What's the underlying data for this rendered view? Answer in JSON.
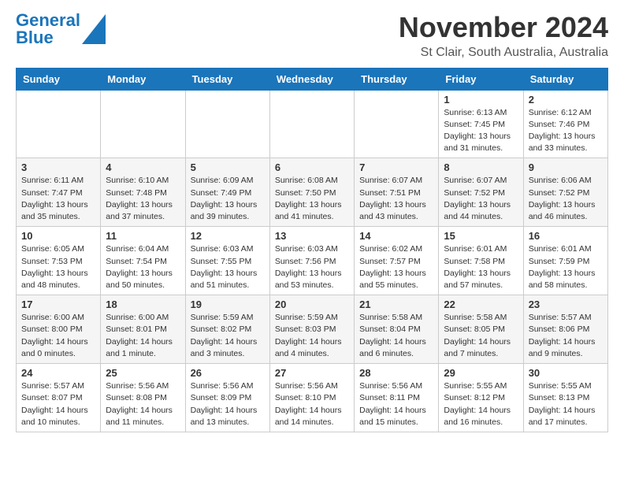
{
  "header": {
    "logo_line1": "General",
    "logo_line2": "Blue",
    "month": "November 2024",
    "location": "St Clair, South Australia, Australia"
  },
  "weekdays": [
    "Sunday",
    "Monday",
    "Tuesday",
    "Wednesday",
    "Thursday",
    "Friday",
    "Saturday"
  ],
  "weeks": [
    [
      {
        "day": "",
        "info": ""
      },
      {
        "day": "",
        "info": ""
      },
      {
        "day": "",
        "info": ""
      },
      {
        "day": "",
        "info": ""
      },
      {
        "day": "",
        "info": ""
      },
      {
        "day": "1",
        "info": "Sunrise: 6:13 AM\nSunset: 7:45 PM\nDaylight: 13 hours and 31 minutes."
      },
      {
        "day": "2",
        "info": "Sunrise: 6:12 AM\nSunset: 7:46 PM\nDaylight: 13 hours and 33 minutes."
      }
    ],
    [
      {
        "day": "3",
        "info": "Sunrise: 6:11 AM\nSunset: 7:47 PM\nDaylight: 13 hours and 35 minutes."
      },
      {
        "day": "4",
        "info": "Sunrise: 6:10 AM\nSunset: 7:48 PM\nDaylight: 13 hours and 37 minutes."
      },
      {
        "day": "5",
        "info": "Sunrise: 6:09 AM\nSunset: 7:49 PM\nDaylight: 13 hours and 39 minutes."
      },
      {
        "day": "6",
        "info": "Sunrise: 6:08 AM\nSunset: 7:50 PM\nDaylight: 13 hours and 41 minutes."
      },
      {
        "day": "7",
        "info": "Sunrise: 6:07 AM\nSunset: 7:51 PM\nDaylight: 13 hours and 43 minutes."
      },
      {
        "day": "8",
        "info": "Sunrise: 6:07 AM\nSunset: 7:52 PM\nDaylight: 13 hours and 44 minutes."
      },
      {
        "day": "9",
        "info": "Sunrise: 6:06 AM\nSunset: 7:52 PM\nDaylight: 13 hours and 46 minutes."
      }
    ],
    [
      {
        "day": "10",
        "info": "Sunrise: 6:05 AM\nSunset: 7:53 PM\nDaylight: 13 hours and 48 minutes."
      },
      {
        "day": "11",
        "info": "Sunrise: 6:04 AM\nSunset: 7:54 PM\nDaylight: 13 hours and 50 minutes."
      },
      {
        "day": "12",
        "info": "Sunrise: 6:03 AM\nSunset: 7:55 PM\nDaylight: 13 hours and 51 minutes."
      },
      {
        "day": "13",
        "info": "Sunrise: 6:03 AM\nSunset: 7:56 PM\nDaylight: 13 hours and 53 minutes."
      },
      {
        "day": "14",
        "info": "Sunrise: 6:02 AM\nSunset: 7:57 PM\nDaylight: 13 hours and 55 minutes."
      },
      {
        "day": "15",
        "info": "Sunrise: 6:01 AM\nSunset: 7:58 PM\nDaylight: 13 hours and 57 minutes."
      },
      {
        "day": "16",
        "info": "Sunrise: 6:01 AM\nSunset: 7:59 PM\nDaylight: 13 hours and 58 minutes."
      }
    ],
    [
      {
        "day": "17",
        "info": "Sunrise: 6:00 AM\nSunset: 8:00 PM\nDaylight: 14 hours and 0 minutes."
      },
      {
        "day": "18",
        "info": "Sunrise: 6:00 AM\nSunset: 8:01 PM\nDaylight: 14 hours and 1 minute."
      },
      {
        "day": "19",
        "info": "Sunrise: 5:59 AM\nSunset: 8:02 PM\nDaylight: 14 hours and 3 minutes."
      },
      {
        "day": "20",
        "info": "Sunrise: 5:59 AM\nSunset: 8:03 PM\nDaylight: 14 hours and 4 minutes."
      },
      {
        "day": "21",
        "info": "Sunrise: 5:58 AM\nSunset: 8:04 PM\nDaylight: 14 hours and 6 minutes."
      },
      {
        "day": "22",
        "info": "Sunrise: 5:58 AM\nSunset: 8:05 PM\nDaylight: 14 hours and 7 minutes."
      },
      {
        "day": "23",
        "info": "Sunrise: 5:57 AM\nSunset: 8:06 PM\nDaylight: 14 hours and 9 minutes."
      }
    ],
    [
      {
        "day": "24",
        "info": "Sunrise: 5:57 AM\nSunset: 8:07 PM\nDaylight: 14 hours and 10 minutes."
      },
      {
        "day": "25",
        "info": "Sunrise: 5:56 AM\nSunset: 8:08 PM\nDaylight: 14 hours and 11 minutes."
      },
      {
        "day": "26",
        "info": "Sunrise: 5:56 AM\nSunset: 8:09 PM\nDaylight: 14 hours and 13 minutes."
      },
      {
        "day": "27",
        "info": "Sunrise: 5:56 AM\nSunset: 8:10 PM\nDaylight: 14 hours and 14 minutes."
      },
      {
        "day": "28",
        "info": "Sunrise: 5:56 AM\nSunset: 8:11 PM\nDaylight: 14 hours and 15 minutes."
      },
      {
        "day": "29",
        "info": "Sunrise: 5:55 AM\nSunset: 8:12 PM\nDaylight: 14 hours and 16 minutes."
      },
      {
        "day": "30",
        "info": "Sunrise: 5:55 AM\nSunset: 8:13 PM\nDaylight: 14 hours and 17 minutes."
      }
    ]
  ]
}
